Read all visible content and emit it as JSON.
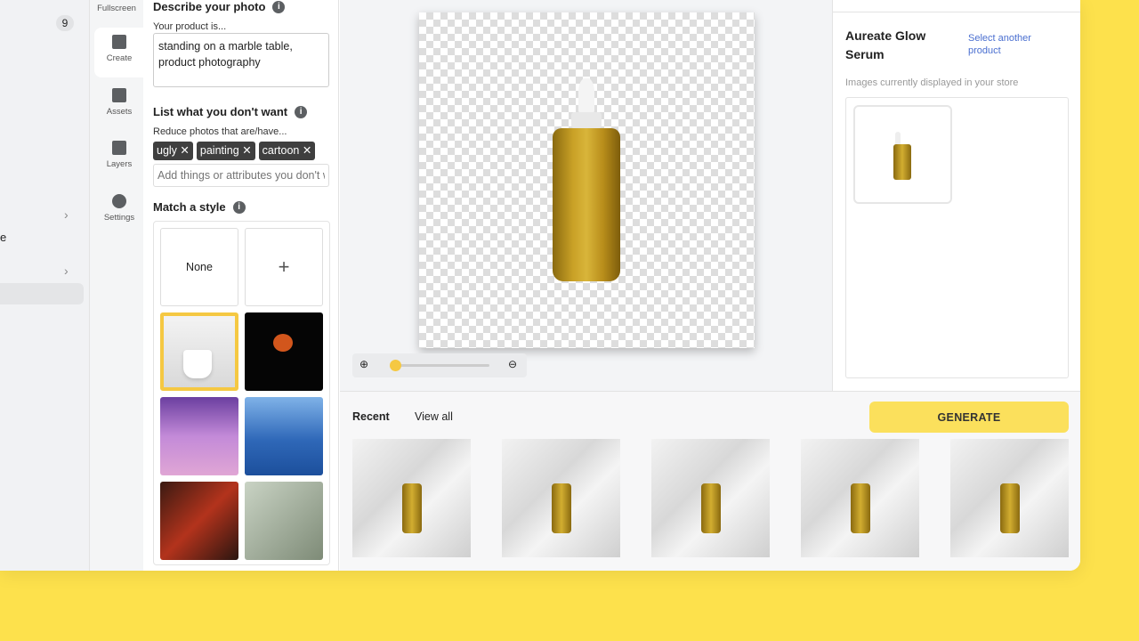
{
  "sidebar": {
    "badge": "9",
    "partial_label": "e"
  },
  "rail": {
    "fullscreen": "Fullscreen",
    "items": [
      {
        "label": "Create",
        "icon": "image-icon"
      },
      {
        "label": "Assets",
        "icon": "archive-icon"
      },
      {
        "label": "Layers",
        "icon": "layers-icon"
      },
      {
        "label": "Settings",
        "icon": "gear-icon"
      }
    ]
  },
  "describe": {
    "title": "Describe your photo",
    "label": "Your product is...",
    "value": "standing on a marble table, product photography"
  },
  "negative": {
    "title": "List what you don't want",
    "label": "Reduce photos that are/have...",
    "tags": [
      "ugly",
      "painting",
      "cartoon"
    ],
    "placeholder": "Add things or attributes you don't want"
  },
  "style": {
    "title": "Match a style",
    "none": "None",
    "add": "+",
    "selected": "white mug"
  },
  "right": {
    "product": "Aureate Glow Serum",
    "select_link": "Select another product",
    "images_label": "Images currently displayed in your store"
  },
  "bottom": {
    "recent": "Recent",
    "view_all": "View all",
    "generate": "GENERATE"
  },
  "zoom": {
    "level": 0.03
  },
  "colors": {
    "accent": "#fbe05c",
    "link": "#4a6fd0",
    "background": "#fde14c"
  }
}
